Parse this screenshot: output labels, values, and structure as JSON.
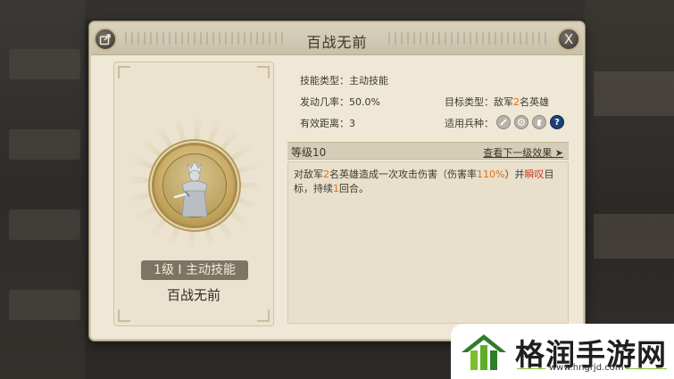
{
  "dialog": {
    "title": "百战无前",
    "close_label": "X"
  },
  "skill_card": {
    "level_type": "1级 I 主动技能",
    "name": "百战无前"
  },
  "info": {
    "skill_type": "技能类型：主动技能",
    "trigger_rate": "发动几率：50.0%",
    "target_prefix": "目标类型：敌军",
    "target_count": "2",
    "target_suffix": "名英雄",
    "range": "有效距离：3",
    "troop_label": "适用兵种："
  },
  "troop_icons": [
    "sword-troop-icon",
    "shield-troop-icon",
    "horse-troop-icon",
    "help-icon"
  ],
  "level": {
    "label": "等级10",
    "next_link": "查看下一级效果 ➤"
  },
  "description": {
    "p1": "对敌军",
    "n1": "2",
    "p2": "名英雄造成一次攻击伤害（伤害率",
    "n2": "110%",
    "p3": "）并",
    "status": "瞬叹",
    "p4": "目标，持续",
    "n3": "1",
    "p5": "回合。"
  },
  "watermark": {
    "text": "格润手游网",
    "url": "www.hngrjd.com"
  },
  "colors": {
    "panel": "#efe8d6",
    "accent_orange": "#e0701d",
    "status_red": "#d9381f"
  }
}
